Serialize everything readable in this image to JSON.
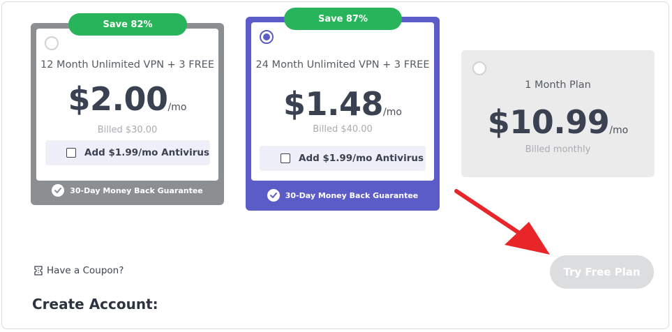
{
  "plans": [
    {
      "badge": "Save 82%",
      "name": "12 Month Unlimited VPN + 3 FREE",
      "price": "$2.00",
      "per": "/mo",
      "billed": "Billed $30.00",
      "addon": "Add $1.99/mo Antivirus",
      "guarantee": "30-Day Money Back Guarantee",
      "selected": false
    },
    {
      "badge": "Save 87%",
      "name": "24 Month Unlimited VPN + 3 FREE",
      "price": "$1.48",
      "per": "/mo",
      "billed": "Billed $40.00",
      "addon": "Add $1.99/mo Antivirus",
      "guarantee": "30-Day Money Back Guarantee",
      "selected": true
    },
    {
      "name": "1 Month Plan",
      "price": "$10.99",
      "per": "/mo",
      "billed": "Billed monthly",
      "selected": false
    }
  ],
  "coupon": {
    "label": "Have a Coupon?"
  },
  "try_button": {
    "label": "Try Free Plan"
  },
  "create_account": {
    "title": "Create Account:"
  },
  "colors": {
    "accent": "#5b5cc7",
    "badge_green": "#28b45a",
    "arrow_red": "#e8262a"
  }
}
